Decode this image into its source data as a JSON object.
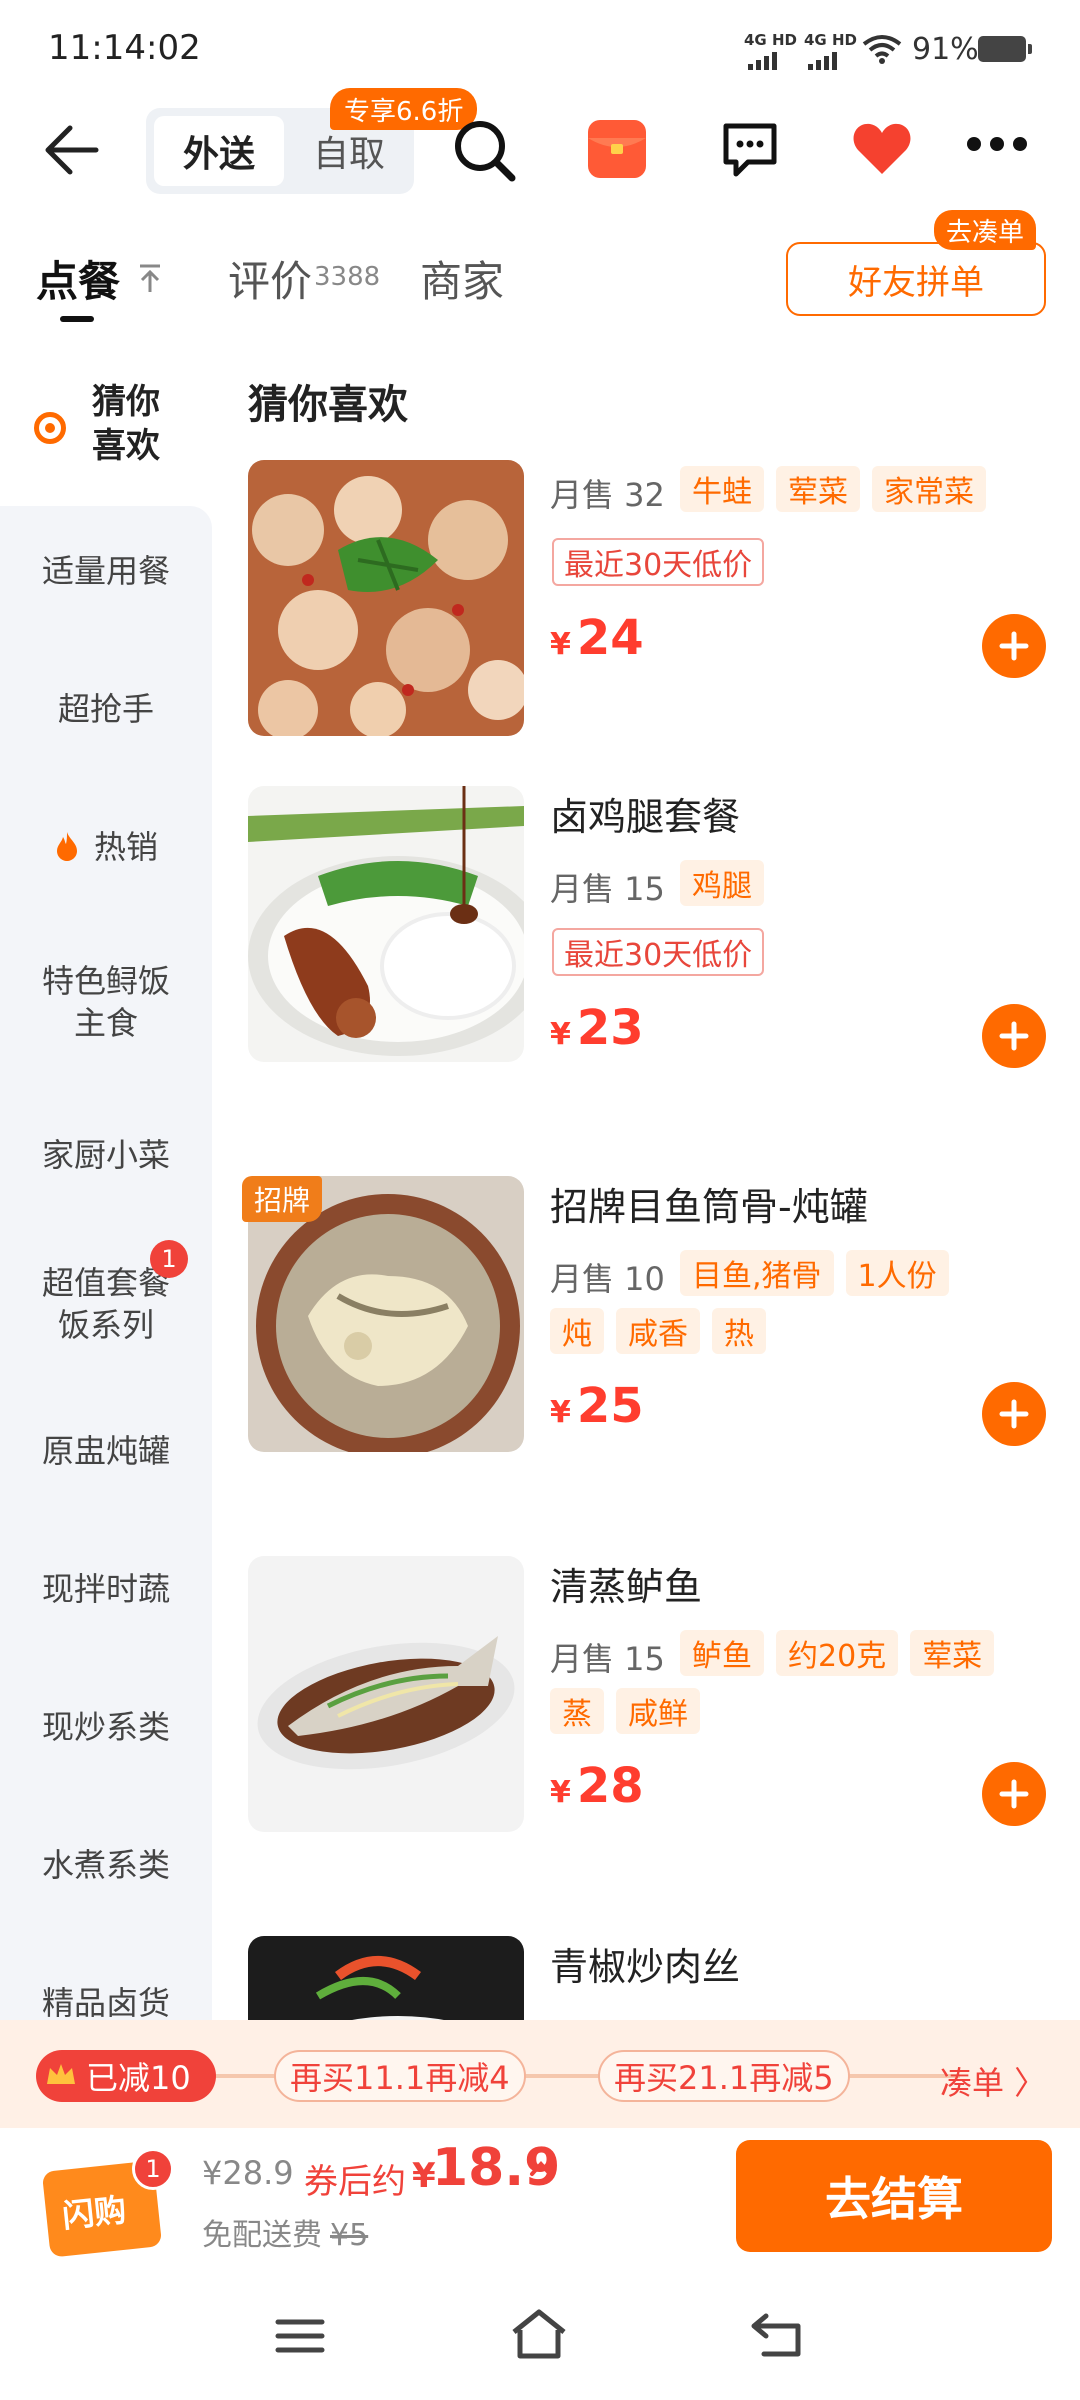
{
  "status": {
    "time": "11:14:02",
    "net1": "4G HD",
    "net2": "4G HD",
    "battery": "91%"
  },
  "header": {
    "delivery": "外送",
    "pickup": "自取",
    "discount_badge": "专享6.6折"
  },
  "tabs": {
    "order": "点餐",
    "reviews": "评价",
    "reviews_count": "3388",
    "merchant": "商家"
  },
  "friend_order": {
    "label": "好友拼单",
    "badge": "去凑单"
  },
  "sidebar": {
    "active": [
      "猜你",
      "喜欢"
    ],
    "items": [
      "适量用餐",
      "超抢手",
      "热销",
      "特色鲟饭",
      "主食",
      "家厨小菜",
      "超值套餐",
      "饭系列",
      "原盅炖罐",
      "现拌时蔬",
      "现炒系类",
      "水煮系类",
      "精品卤货"
    ],
    "badge": "1"
  },
  "section_title": "猜你喜欢",
  "items": [
    {
      "name": "",
      "sales": "月售 32",
      "tags": [
        "牛蛙",
        "荤菜",
        "家常菜"
      ],
      "low_price": "最近30天低价",
      "currency": "¥",
      "price": "24"
    },
    {
      "name": "卤鸡腿套餐",
      "sales": "月售 15",
      "tags": [
        "鸡腿"
      ],
      "low_price": "最近30天低价",
      "currency": "¥",
      "price": "23"
    },
    {
      "name": "招牌目鱼筒骨-炖罐",
      "sales": "月售 10",
      "tags": [
        "目鱼,猪骨",
        "1人份"
      ],
      "tags2": [
        "炖",
        "咸香",
        "热"
      ],
      "badge": "招牌",
      "currency": "¥",
      "price": "25"
    },
    {
      "name": "清蒸鲈鱼",
      "sales": "月售 15",
      "tags": [
        "鲈鱼",
        "约20克",
        "荤菜"
      ],
      "tags2": [
        "蒸",
        "咸鲜"
      ],
      "currency": "¥",
      "price": "28"
    },
    {
      "name": "青椒炒肉丝"
    }
  ],
  "promo": {
    "reached": "已减10",
    "step1": "再买11.1再减4",
    "step2": "再买21.1再减5",
    "link": "凑单 〉"
  },
  "checkout": {
    "cart_icon_text": "闪购",
    "cart_count": "1",
    "original_price": "¥28.9",
    "after_label": "券后约",
    "after_currency": "¥",
    "after_price": "18.9",
    "delivery_free": "免配送费",
    "delivery_fee": "¥5",
    "pay_label": "去结算"
  },
  "colors": {
    "accent": "#ff6a00",
    "price": "#ff3d2e",
    "sidebar_bg": "#f3f5f9"
  }
}
